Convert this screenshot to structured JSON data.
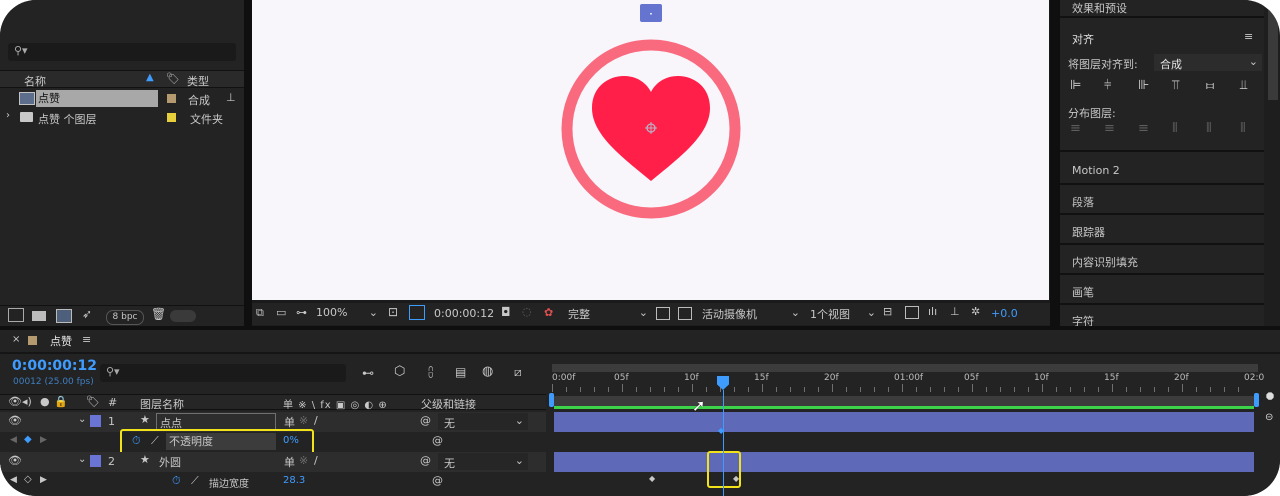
{
  "project": {
    "search_placeholder": "",
    "col_name": "名称",
    "col_type": "类型",
    "items": [
      {
        "name": "点赞",
        "type": "合成",
        "label_color": "#b49a6e"
      },
      {
        "name": "点赞 个图层",
        "type": "文件夹",
        "label_color": "#e6cf3a"
      }
    ],
    "bpc": "8 bpc"
  },
  "viewer": {
    "zoom": "100%",
    "timecode": "0:00:00:12",
    "resolution": "完整",
    "camera": "活动摄像机",
    "views": "1个视图",
    "exposure": "+0.0",
    "heart_color": "#ff1f48",
    "ring_color": "#f96a7f",
    "background": "#f8f6fb"
  },
  "right_panel": {
    "effects_presets": "效果和预设",
    "align_title": "对齐",
    "align_to_label": "将图层对齐到:",
    "align_to_value": "合成",
    "distribute_label": "分布图层:",
    "sections": [
      "Motion 2",
      "段落",
      "跟踪器",
      "内容识别填充",
      "画笔",
      "字符"
    ]
  },
  "timeline": {
    "comp_name": "点赞",
    "timecode": "0:00:00:12",
    "timecode_sub": "00012 (25.00 fps)",
    "search_placeholder": "",
    "col_hash": "#",
    "col_layer_name": "图层名称",
    "col_switches": "单 ※ \\ fx ▣ ◎ ◐ ⊕",
    "col_parent": "父级和链接",
    "layers": [
      {
        "num": "1",
        "name": "点点",
        "parent": "无",
        "color": "#6a74d4"
      },
      {
        "num": "2",
        "name": "外圆",
        "parent": "无",
        "color": "#6a74d4"
      }
    ],
    "opacity_label": "不透明度",
    "opacity_value": "0%",
    "stroke_label": "描边宽度",
    "stroke_value": "28.3",
    "ruler_labels": [
      "0:00f",
      "05f",
      "10f",
      "15f",
      "20f",
      "01:00f",
      "05f",
      "10f",
      "15f",
      "20f",
      "02:0"
    ],
    "playhead_frame": 12
  }
}
